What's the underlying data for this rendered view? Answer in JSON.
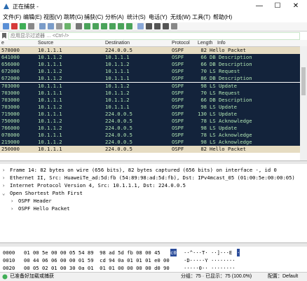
{
  "window": {
    "title": "正在捕获 -",
    "minimize": "—",
    "maximize": "☐",
    "close": "✕"
  },
  "menu": [
    "文件(F)",
    "编辑(E)",
    "视图(V)",
    "跳转(G)",
    "捕获(C)",
    "分析(A)",
    "统计(S)",
    "电话(Y)",
    "无线(W)",
    "工具(T)",
    "帮助(H)"
  ],
  "filter": {
    "placeholder": "应用显示过滤器 … <Ctrl-/>"
  },
  "columns": {
    "no": "e",
    "source": "Source",
    "destination": "Destination",
    "protocol": "Protocol",
    "length": "Length",
    "info": "Info"
  },
  "packets": [
    {
      "time": "578000",
      "src": "10.1.1.1",
      "dst": "224.0.0.5",
      "proto": "OSPF",
      "len": "82",
      "info": "Hello Packet",
      "style": "light"
    },
    {
      "time": "641000",
      "src": "10.1.1.2",
      "dst": "10.1.1.1",
      "proto": "OSPF",
      "len": "66",
      "info": "DB Description",
      "style": "sel"
    },
    {
      "time": "656000",
      "src": "10.1.1.1",
      "dst": "10.1.1.2",
      "proto": "OSPF",
      "len": "66",
      "info": "DB Description",
      "style": "sel"
    },
    {
      "time": "672000",
      "src": "10.1.1.2",
      "dst": "10.1.1.1",
      "proto": "OSPF",
      "len": "70",
      "info": "LS Request",
      "style": "sel"
    },
    {
      "time": "672000",
      "src": "10.1.1.2",
      "dst": "10.1.1.1",
      "proto": "OSPF",
      "len": "86",
      "info": "DB Description",
      "style": "sel"
    },
    {
      "time": "703000",
      "src": "10.1.1.1",
      "dst": "10.1.1.2",
      "proto": "OSPF",
      "len": "98",
      "info": "LS Update",
      "style": "sel"
    },
    {
      "time": "703000",
      "src": "10.1.1.1",
      "dst": "10.1.1.2",
      "proto": "OSPF",
      "len": "70",
      "info": "LS Request",
      "style": "sel"
    },
    {
      "time": "703000",
      "src": "10.1.1.1",
      "dst": "10.1.1.2",
      "proto": "OSPF",
      "len": "66",
      "info": "DB Description",
      "style": "sel"
    },
    {
      "time": "703000",
      "src": "10.1.1.2",
      "dst": "10.1.1.1",
      "proto": "OSPF",
      "len": "98",
      "info": "LS Update",
      "style": "sel"
    },
    {
      "time": "719000",
      "src": "10.1.1.1",
      "dst": "224.0.0.5",
      "proto": "OSPF",
      "len": "130",
      "info": "LS Update",
      "style": "sel"
    },
    {
      "time": "750000",
      "src": "10.1.1.2",
      "dst": "224.0.0.5",
      "proto": "OSPF",
      "len": "78",
      "info": "LS Acknowledge",
      "style": "sel"
    },
    {
      "time": "766000",
      "src": "10.1.1.2",
      "dst": "224.0.0.5",
      "proto": "OSPF",
      "len": "98",
      "info": "LS Update",
      "style": "sel"
    },
    {
      "time": "078000",
      "src": "10.1.1.1",
      "dst": "224.0.0.5",
      "proto": "OSPF",
      "len": "78",
      "info": "LS Acknowledge",
      "style": "sel"
    },
    {
      "time": "219000",
      "src": "10.1.1.2",
      "dst": "224.0.0.5",
      "proto": "OSPF",
      "len": "98",
      "info": "LS Acknowledge",
      "style": "sel"
    },
    {
      "time": "250000",
      "src": "10.1.1.1",
      "dst": "224.0.0.5",
      "proto": "OSPF",
      "len": "82",
      "info": "Hello Packet",
      "style": "light"
    }
  ],
  "details": [
    {
      "arrow": "›",
      "text": "Frame 14: 82 bytes on wire (656 bits), 82 bytes captured (656 bits) on interface -, id 0",
      "indent": 0
    },
    {
      "arrow": "›",
      "text": "Ethernet II, Src: HuaweiTe_ad:5d:fb (54:89:98:ad:5d:fb), Dst: IPv4mcast_05 (01:00:5e:00:00:05)",
      "indent": 0
    },
    {
      "arrow": "›",
      "text": "Internet Protocol Version 4, Src: 10.1.1.1, Dst: 224.0.0.5",
      "indent": 0
    },
    {
      "arrow": "⌄",
      "text": "Open Shortest Path First",
      "indent": 0
    },
    {
      "arrow": "›",
      "text": "OSPF Header",
      "indent": 1
    },
    {
      "arrow": "›",
      "text": "OSPF Hello Packet",
      "indent": 1
    }
  ],
  "bytes": [
    {
      "offset": "0000",
      "hex": "01 00 5e 00 00 05 54 89  98 ad 5d fb 08 00 45",
      "hl": "c0",
      "ascii": "··^···T· ··]···E",
      "hl_ascii": "·"
    },
    {
      "offset": "0010",
      "hex": "00 44 06 06 00 00 01 59  cd 94 0a 01 01 01 e0 00",
      "hl": "",
      "ascii": "·D·····Y ········",
      "hl_ascii": ""
    },
    {
      "offset": "0020",
      "hex": "00 05 02 01 00 30 0a 01  01 01 00 00 00 00 d0 90",
      "hl": "",
      "ascii": "·····0·· ········",
      "hl_ascii": ""
    }
  ],
  "status": {
    "left": "已准备好加载或捕获",
    "packets": "分组：75 · 已显示：75 (100.0%)",
    "profile": "配置：Default"
  },
  "colors": {
    "selected_bg": "#13233b",
    "selected_fg": "#b0e5b3",
    "hello_bg": "#e6dcc2",
    "accent": "#2c4d9b"
  }
}
